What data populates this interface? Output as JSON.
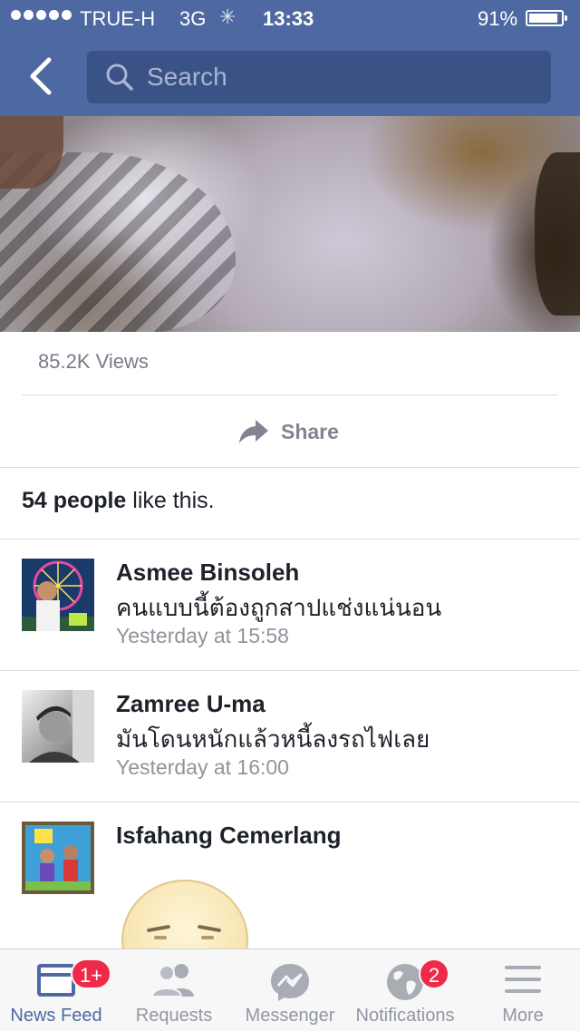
{
  "status_bar": {
    "carrier": "TRUE-H",
    "network": "3G",
    "time": "13:33",
    "battery_percent": "91%",
    "battery_level": 0.91
  },
  "header": {
    "search_placeholder": "Search"
  },
  "video": {
    "views": "85.2K Views",
    "share_label": "Share"
  },
  "likes": {
    "count_text": "54 people",
    "suffix": " like this."
  },
  "comments": [
    {
      "name": "Asmee Binsoleh",
      "text": "คนแบบนี้ต้องถูกสาปแช่งแน่นอน",
      "time": "Yesterday at 15:58"
    },
    {
      "name": "Zamree U-ma",
      "text": "มันโดนหนักแล้วหนี้ลงรถไฟเลย",
      "time": "Yesterday at 16:00"
    },
    {
      "name": "Isfahang Cemerlang",
      "text": "",
      "time": ""
    }
  ],
  "tab_bar": {
    "tabs": [
      {
        "label": "News Feed",
        "icon": "news-feed-icon",
        "badge": "1+",
        "active": true
      },
      {
        "label": "Requests",
        "icon": "friend-requests-icon",
        "badge": "",
        "active": false
      },
      {
        "label": "Messenger",
        "icon": "messenger-icon",
        "badge": "",
        "active": false
      },
      {
        "label": "Notifications",
        "icon": "globe-icon",
        "badge": "2",
        "active": false
      },
      {
        "label": "More",
        "icon": "hamburger-menu-icon",
        "badge": "",
        "active": false
      }
    ]
  },
  "colors": {
    "brand_blue": "#4e69a2",
    "search_field": "#3b5286",
    "badge_red": "#f02849"
  }
}
